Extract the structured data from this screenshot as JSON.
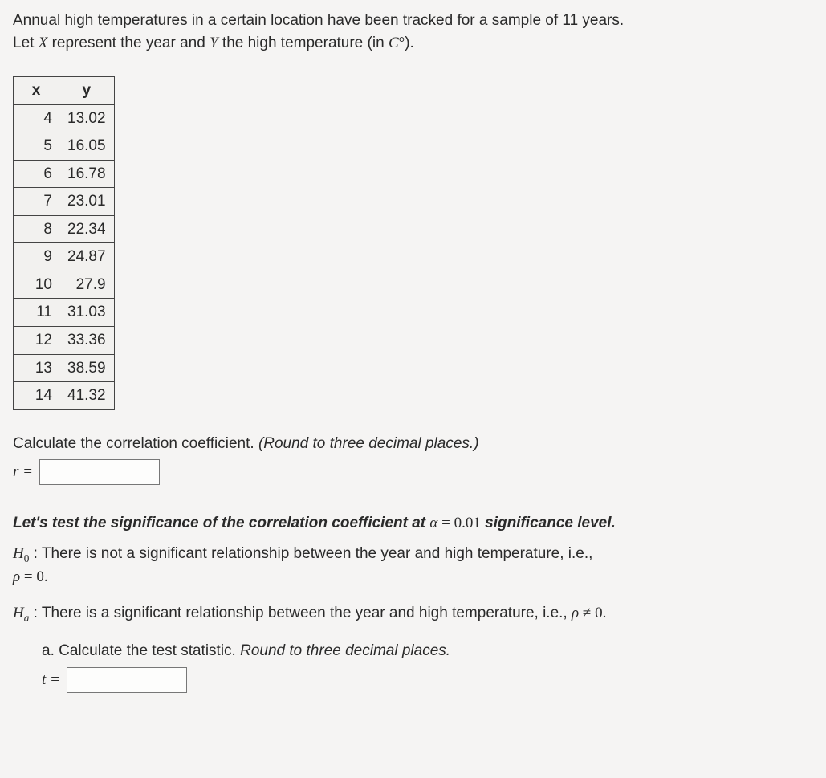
{
  "intro": {
    "line1_a": "Annual high temperatures in a certain location have been tracked for a sample of 11 years.",
    "line2_a": "Let ",
    "line2_X": "X",
    "line2_b": " represent the year and ",
    "line2_Y": "Y",
    "line2_c": " the high temperature (in ",
    "line2_C": "C",
    "line2_deg": "°",
    "line2_d": ")."
  },
  "table": {
    "headers": {
      "x": "x",
      "y": "y"
    },
    "rows": [
      {
        "x": "4",
        "y": "13.02"
      },
      {
        "x": "5",
        "y": "16.05"
      },
      {
        "x": "6",
        "y": "16.78"
      },
      {
        "x": "7",
        "y": "23.01"
      },
      {
        "x": "8",
        "y": "22.34"
      },
      {
        "x": "9",
        "y": "24.87"
      },
      {
        "x": "10",
        "y": "27.9"
      },
      {
        "x": "11",
        "y": "31.03"
      },
      {
        "x": "12",
        "y": "33.36"
      },
      {
        "x": "13",
        "y": "38.59"
      },
      {
        "x": "14",
        "y": "41.32"
      }
    ]
  },
  "q_corr": {
    "prompt_a": "Calculate the correlation coefficient. ",
    "prompt_b": "(Round to three decimal places.)",
    "var": "r",
    "eq": " ="
  },
  "sig": {
    "lead_a": "Let's test the significance of the correlation coefficient at ",
    "alpha": "α",
    "eq": " = ",
    "val": "0.01",
    "lead_b": " significance level."
  },
  "h0": {
    "sym": "H",
    "sub": "0",
    "colon": " : ",
    "text": "There is not a significant relationship between the year and high temperature, i.e.,",
    "rho": "ρ",
    "eq": " = ",
    "val": "0."
  },
  "ha": {
    "sym": "H",
    "sub": "a",
    "colon": " : ",
    "text": "There is a significant relationship between the year and high temperature, i.e., ",
    "rho": "ρ",
    "neq": " ≠ ",
    "val": "0."
  },
  "part_a": {
    "label": "a. Calculate the test statistic. ",
    "note": "Round to three decimal places.",
    "var": "t",
    "eq": " ="
  }
}
